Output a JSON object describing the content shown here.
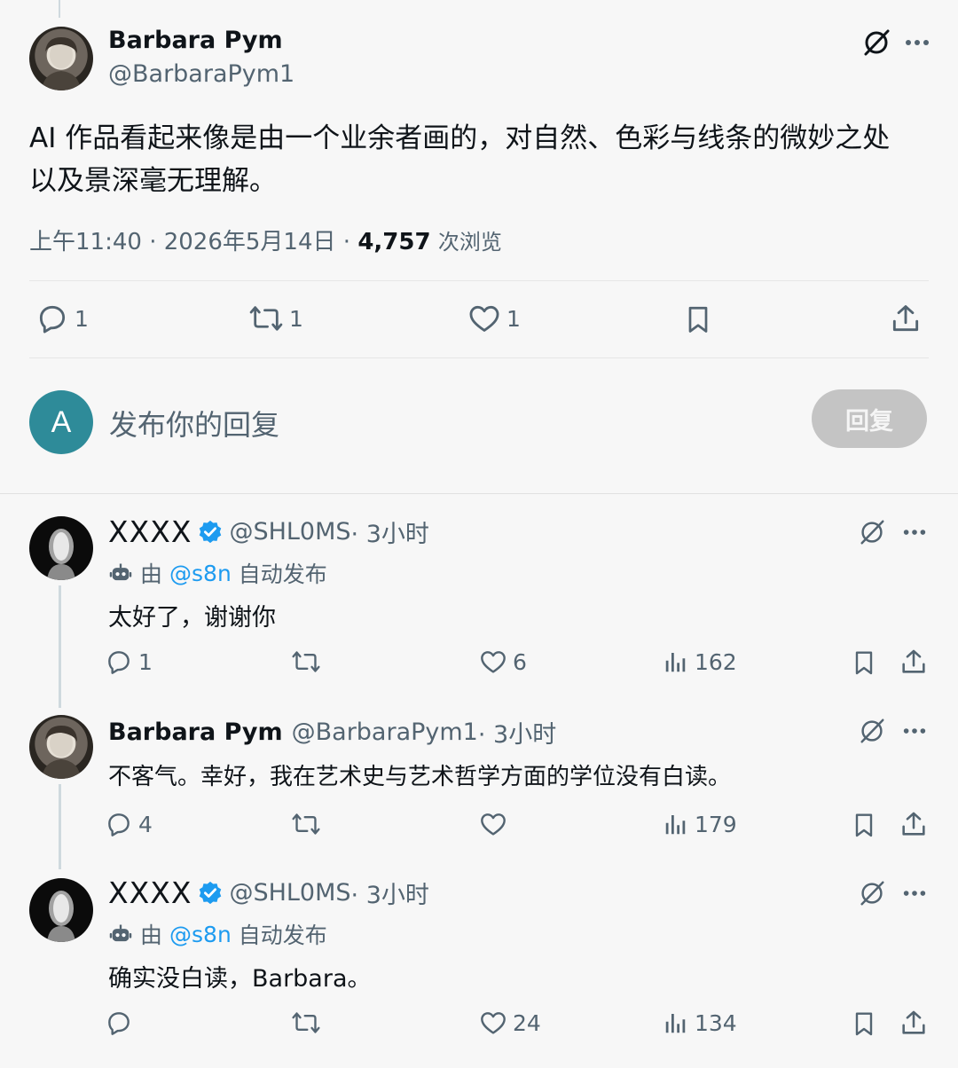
{
  "main_tweet": {
    "author_name": "Barbara Pym",
    "author_handle": "@BarbaraPym1",
    "text_line1": "AI 作品看起来像是由一个业余者画的，对自然、色彩与线条的微妙之处",
    "text_line2": "以及景深毫无理解。",
    "time": "上午11:40 · 2026年5月14日 · ",
    "views_count": "4,757",
    "views_label": "次浏览",
    "replies": "1",
    "retweets": "1",
    "likes": "1"
  },
  "composer": {
    "avatar_letter": "A",
    "avatar_color": "#2e8b99",
    "placeholder": "发布你的回复",
    "reply_button": "回复"
  },
  "replies": [
    {
      "author_name": "XXXX",
      "author_handle": "@SHL0MS",
      "time": " · 3小时",
      "automated_prefix": "由",
      "automated_handle": "@s8n",
      "automated_suffix": "自动发布",
      "text": "太好了，谢谢你",
      "replies": "1",
      "retweets": "",
      "likes": "6",
      "views": "162"
    },
    {
      "author_name": "Barbara Pym",
      "author_handle": "@BarbaraPym1",
      "time": " · 3小时",
      "text": "不客气。幸好，我在艺术史与艺术哲学方面的学位没有白读。",
      "replies": "4",
      "retweets": "",
      "likes": "",
      "views": "179"
    },
    {
      "author_name": "XXXX",
      "author_handle": "@SHL0MS",
      "time": " · 3小时",
      "automated_prefix": "由",
      "automated_handle": "@s8n",
      "automated_suffix": "自动发布",
      "text": "确实没白读，Barbara。",
      "replies": "",
      "retweets": "",
      "likes": "24",
      "views": "134"
    }
  ],
  "colors": {
    "background": "#f7f7f7",
    "text": "#0f1419",
    "muted": "#536471",
    "link": "#1d9bf0",
    "verified": "#1d9bf0",
    "reply_button_bg": "#c4c4c4"
  }
}
